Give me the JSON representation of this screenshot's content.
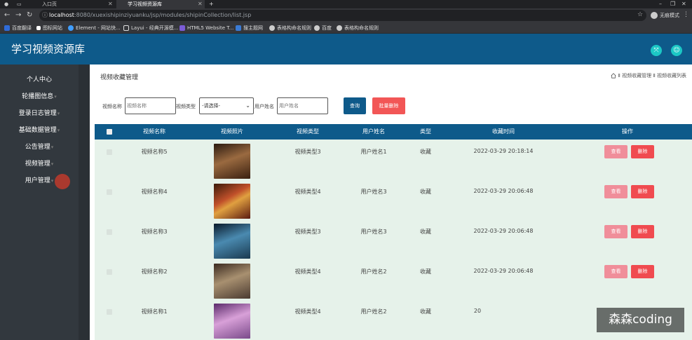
{
  "browser": {
    "tabs": [
      {
        "label": ""
      },
      {
        "label": ""
      },
      {
        "label": "入口页"
      },
      {
        "label": "学习视频资源库"
      }
    ],
    "new_tab": "+",
    "url_host": "localhost",
    "url_rest": ":8080/xuexishipinziyuanku/jsp/modules/shipinCollection/list.jsp",
    "profile_label": "无痕模式",
    "bookmarks": [
      {
        "label": "百度翻译",
        "color": "#2f6bd8"
      },
      {
        "label": "图标网站",
        "color": "#ffffff"
      },
      {
        "label": "Element - 网站快...",
        "color": "#409eff"
      },
      {
        "label": "Layui - 经典开源模...",
        "color": "#ffffff"
      },
      {
        "label": "HTML5 Website T...",
        "color": "#7b5cd6"
      },
      {
        "label": "搜主题网",
        "color": "#3a7bd5"
      },
      {
        "label": "表格构命名规则",
        "color": "#cccccc"
      },
      {
        "label": "百度",
        "color": "#cccccc"
      },
      {
        "label": "表格构命名规则",
        "color": "#cccccc"
      }
    ]
  },
  "app": {
    "title": "学习视频资源库",
    "accent": "#0e5a8a",
    "header_icon_color": "#1cc7c5"
  },
  "sidebar": {
    "items": [
      {
        "label": "个人中心",
        "caret": ""
      },
      {
        "label": "轮播图信息",
        "caret": "▾"
      },
      {
        "label": "登录日志管理",
        "caret": "▾"
      },
      {
        "label": "基础数据管理",
        "caret": "▾"
      },
      {
        "label": "公告管理",
        "caret": "▾"
      },
      {
        "label": "视频管理",
        "caret": "▾"
      },
      {
        "label": "用户管理",
        "caret": "▾"
      }
    ]
  },
  "page": {
    "title": "视频收藏管理",
    "breadcrumb": "Ⅱ 视频收藏管理 Ⅱ 视频收藏列表"
  },
  "filters": {
    "name_label": "视频名称",
    "name_placeholder": "视频名称",
    "type_label": "视频类型",
    "type_value": "-请选择-",
    "user_label": "用户姓名",
    "user_placeholder": "用户姓名",
    "search_button": "查询",
    "batch_delete_button": "批量删除"
  },
  "table": {
    "columns": [
      "视频名称",
      "视频照片",
      "视频类型",
      "用户姓名",
      "类型",
      "收藏时间",
      "操作"
    ],
    "view_label": "查看",
    "delete_label": "删除",
    "rows": [
      {
        "name": "视频名称5",
        "type": "视频类型3",
        "user": "用户姓名1",
        "kind": "收藏",
        "time": "2022-03-29 20:18:14",
        "thumb": "#5a3520"
      },
      {
        "name": "视频名称4",
        "type": "视频类型4",
        "user": "用户姓名3",
        "kind": "收藏",
        "time": "2022-03-29 20:06:48",
        "thumb": "#8a2a1a"
      },
      {
        "name": "视频名称3",
        "type": "视频类型3",
        "user": "用户姓名3",
        "kind": "收藏",
        "time": "2022-03-29 20:06:48",
        "thumb": "#3a6a8a"
      },
      {
        "name": "视频名称2",
        "type": "视频类型4",
        "user": "用户姓名2",
        "kind": "收藏",
        "time": "2022-03-29 20:06:48",
        "thumb": "#6a5a4a"
      },
      {
        "name": "视频名称1",
        "type": "视频类型4",
        "user": "用户姓名2",
        "kind": "收藏",
        "time": "20",
        "thumb": "#b080b0"
      }
    ]
  },
  "watermark": "森森coding"
}
